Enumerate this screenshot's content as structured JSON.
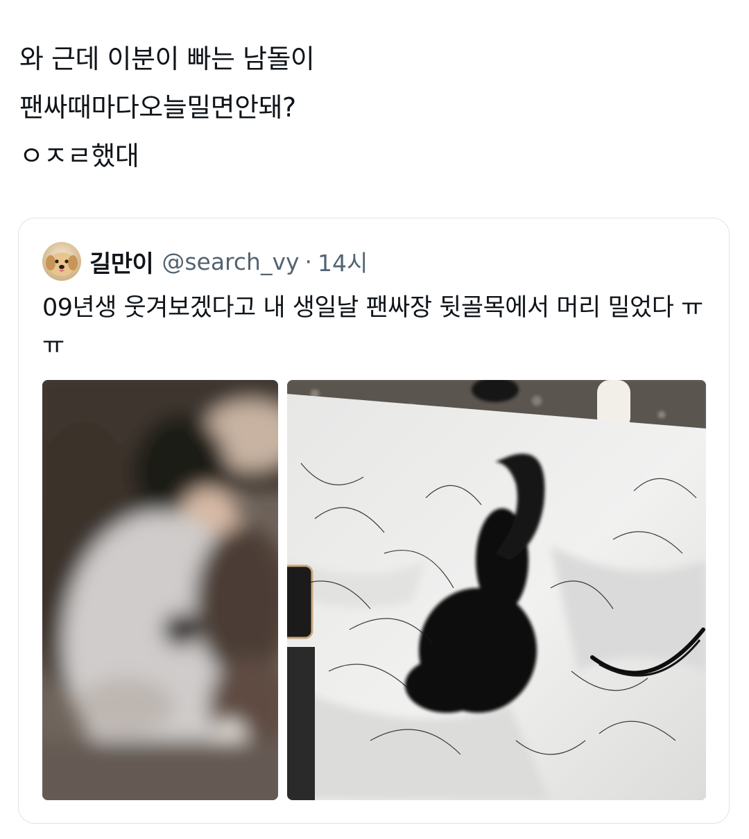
{
  "tweet": {
    "lines": [
      "와 근데 이분이 빠는 남돌이",
      "팬싸때마다오늘밀면안돼?",
      "ㅇㅈㄹ했대"
    ]
  },
  "quote": {
    "display_name": "길만이",
    "handle": "@search_vy",
    "separator": "·",
    "time": "14시",
    "text": "09년생 웃겨보겠다고 내 생일날 팬싸장 뒷골목에서 머리 밀었다 ㅠㅠ",
    "avatar_icon": "puppy-avatar-icon",
    "media": [
      {
        "icon": "blurred-person-photo"
      },
      {
        "icon": "cut-hair-photo"
      }
    ]
  },
  "colors": {
    "text": "#0f1419",
    "secondary": "#536471",
    "border": "#dfe3e7"
  }
}
